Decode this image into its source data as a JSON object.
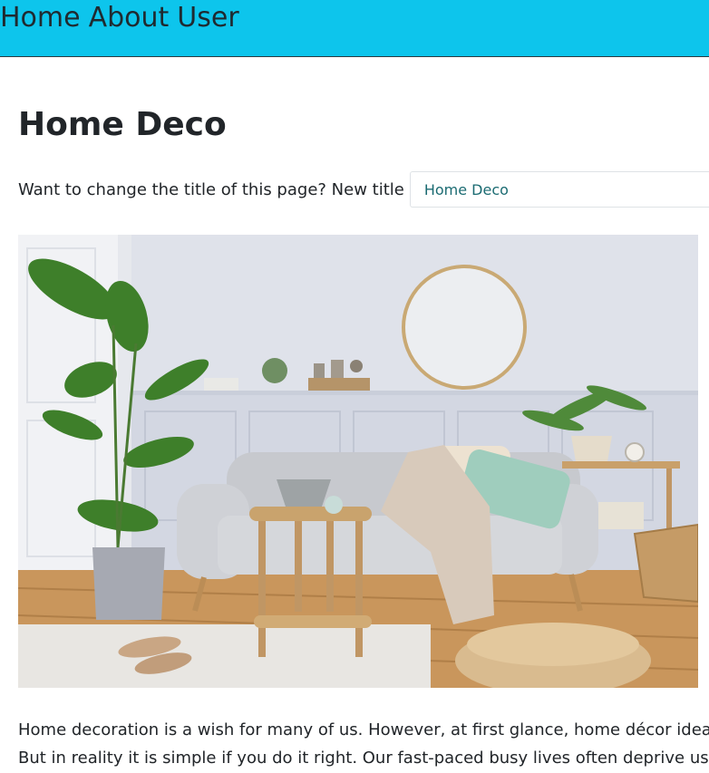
{
  "nav": {
    "items": [
      "Home",
      "About",
      "User"
    ]
  },
  "page": {
    "title": "Home Deco",
    "change_title_label": "Want to change the title of this page? New title",
    "title_input_value": "Home Deco"
  },
  "body_text": {
    "line1": "Home decoration is a wish for many of us. However, at first glance, home décor idea",
    "line2": "But in reality it is simple if you do it right. Our fast-paced busy lives often deprive us"
  },
  "colors": {
    "topbar": "#0dc5ec",
    "heading": "#212529",
    "input_text": "#1b6b72"
  }
}
